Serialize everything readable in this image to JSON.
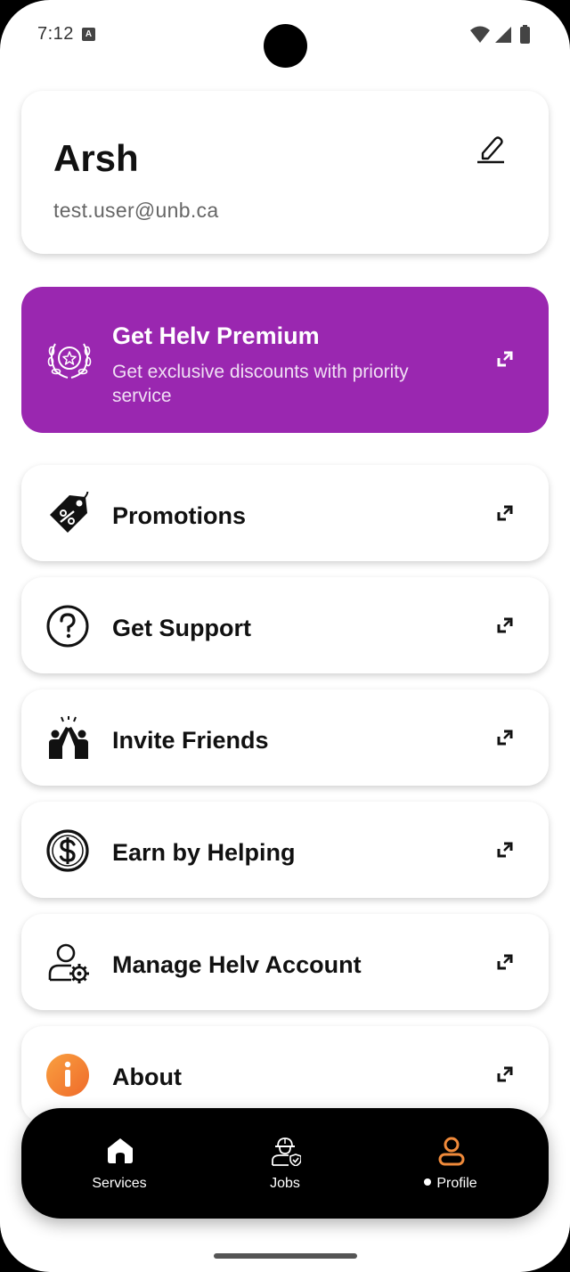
{
  "status_bar": {
    "time": "7:12",
    "notification_badge": "A"
  },
  "profile": {
    "name": "Arsh",
    "email": "test.user@unb.ca"
  },
  "premium": {
    "title": "Get Helv Premium",
    "subtitle": "Get exclusive discounts with priority service",
    "color": "#9a27b0"
  },
  "menu": {
    "items": [
      {
        "label": "Promotions",
        "icon": "promo-tag-icon"
      },
      {
        "label": "Get Support",
        "icon": "question-circle-icon"
      },
      {
        "label": "Invite Friends",
        "icon": "high-five-icon"
      },
      {
        "label": "Earn by Helping",
        "icon": "dollar-circle-icon"
      },
      {
        "label": "Manage Helv Account",
        "icon": "user-gear-icon"
      },
      {
        "label": "About",
        "icon": "info-icon"
      }
    ]
  },
  "nav": {
    "items": [
      {
        "label": "Services",
        "icon": "home-icon"
      },
      {
        "label": "Jobs",
        "icon": "worker-icon"
      },
      {
        "label": "Profile",
        "icon": "person-icon",
        "active": true
      }
    ],
    "active_color": "#f08a3a"
  }
}
